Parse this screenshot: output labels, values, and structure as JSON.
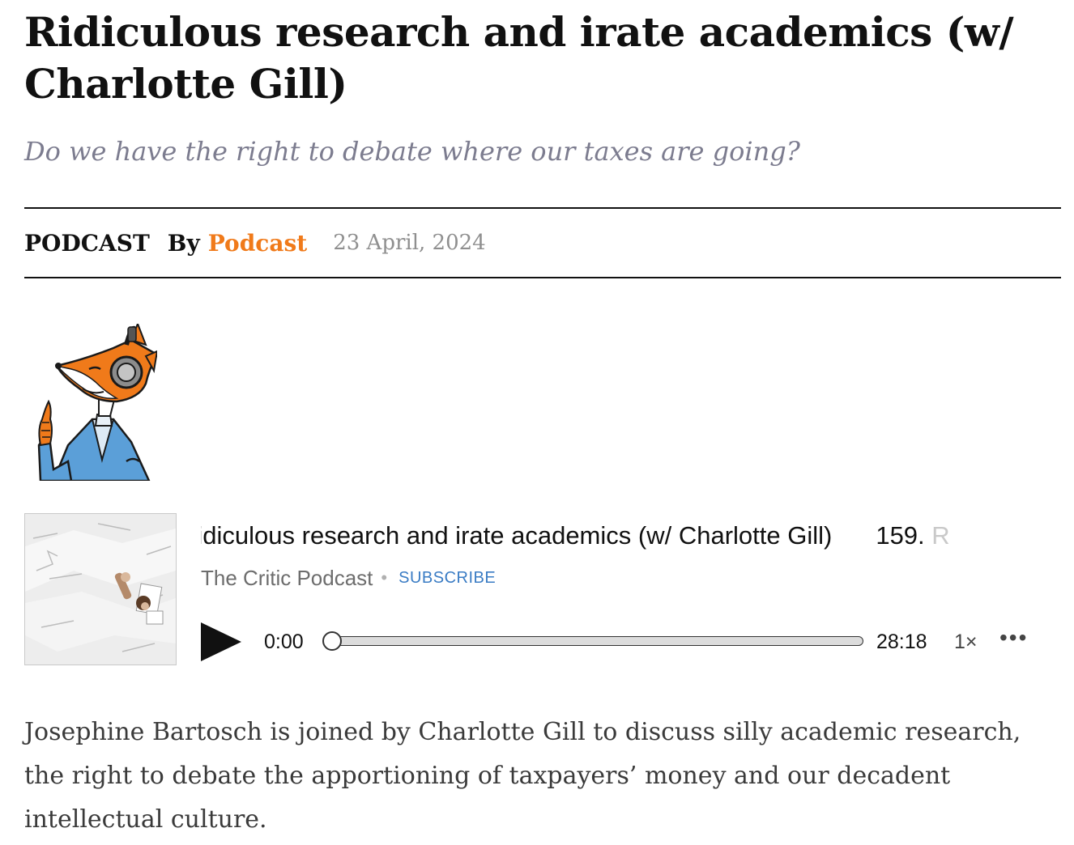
{
  "article": {
    "title": "Ridiculous research and irate academics (w/ Charlotte Gill)",
    "subtitle": "Do we have the right to debate where our taxes are going?",
    "category": "PODCAST",
    "by_label": "By",
    "author": "Podcast",
    "date": "23 April, 2024",
    "body": "Josephine Bartosch is joined by Charlotte Gill to discuss silly academic research, the right to debate the apportioning of taxpayers’ money and our decadent intellectual culture."
  },
  "player": {
    "episode_title_visible": "Ridiculous research and irate academics (w/ Charlotte Gill)",
    "episode_title_next_visible": "159.",
    "episode_title_next_faded": "R",
    "show_name": "The Critic Podcast",
    "separator": "•",
    "subscribe_label": "SUBSCRIBE",
    "current_time": "0:00",
    "duration": "28:18",
    "speed": "1×",
    "more_label": "•••",
    "progress": 0
  },
  "colors": {
    "accent": "#f07a1a",
    "subtitle": "#7c7c8f",
    "link_blue": "#3a7cc4"
  },
  "icons": [
    "fox-mascot-logo",
    "play-icon",
    "more-icon"
  ]
}
